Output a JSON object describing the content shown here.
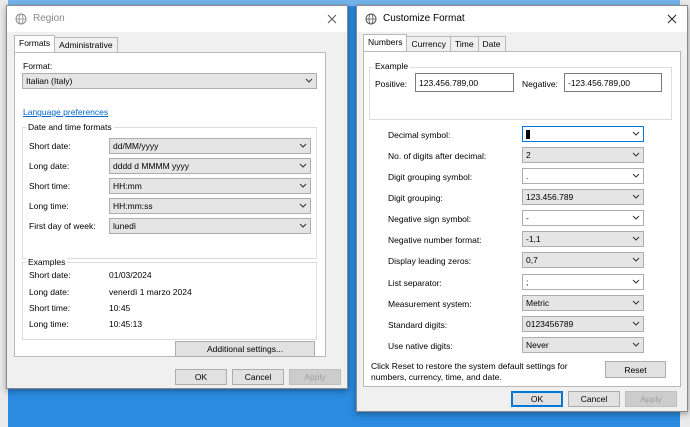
{
  "region": {
    "title": "Region",
    "tabs": [
      "Formats",
      "Administrative"
    ],
    "format_label": "Format:",
    "format_value": "Italian (Italy)",
    "language_link": "Language preferences",
    "datetime_group": "Date and time formats",
    "fields": [
      {
        "label": "Short date:",
        "value": "dd/MM/yyyy"
      },
      {
        "label": "Long date:",
        "value": "dddd d MMMM yyyy"
      },
      {
        "label": "Short time:",
        "value": "HH:mm"
      },
      {
        "label": "Long time:",
        "value": "HH:mm:ss"
      },
      {
        "label": "First day of week:",
        "value": "lunedì"
      }
    ],
    "examples_group": "Examples",
    "examples": [
      {
        "label": "Short date:",
        "value": "01/03/2024"
      },
      {
        "label": "Long date:",
        "value": "venerdì 1 marzo 2024"
      },
      {
        "label": "Short time:",
        "value": "10:45"
      },
      {
        "label": "Long time:",
        "value": "10:45:13"
      }
    ],
    "additional_button": "Additional settings...",
    "ok": "OK",
    "cancel": "Cancel",
    "apply": "Apply"
  },
  "customize": {
    "title": "Customize Format",
    "tabs": [
      "Numbers",
      "Currency",
      "Time",
      "Date"
    ],
    "example_group": "Example",
    "positive_label": "Positive:",
    "positive_value": "123.456.789,00",
    "negative_label": "Negative:",
    "negative_value": "-123.456.789,00",
    "settings": [
      {
        "label": "Decimal symbol:",
        "value": ""
      },
      {
        "label": "No. of digits after decimal:",
        "value": "2"
      },
      {
        "label": "Digit grouping symbol:",
        "value": "."
      },
      {
        "label": "Digit grouping:",
        "value": "123.456.789"
      },
      {
        "label": "Negative sign symbol:",
        "value": "-"
      },
      {
        "label": "Negative number format:",
        "value": "-1,1"
      },
      {
        "label": "Display leading zeros:",
        "value": "0,7"
      },
      {
        "label": "List separator:",
        "value": ";"
      },
      {
        "label": "Measurement system:",
        "value": "Metric"
      },
      {
        "label": "Standard digits:",
        "value": "0123456789"
      },
      {
        "label": "Use native digits:",
        "value": "Never"
      }
    ],
    "reset_note_1": "Click Reset to restore the system default settings for",
    "reset_note_2": "numbers, currency, time, and date.",
    "reset": "Reset",
    "ok": "OK",
    "cancel": "Cancel",
    "apply": "Apply"
  },
  "colors": {
    "accent": "#0078d7",
    "link": "#0066cc",
    "desktop": "#2a8be0"
  }
}
